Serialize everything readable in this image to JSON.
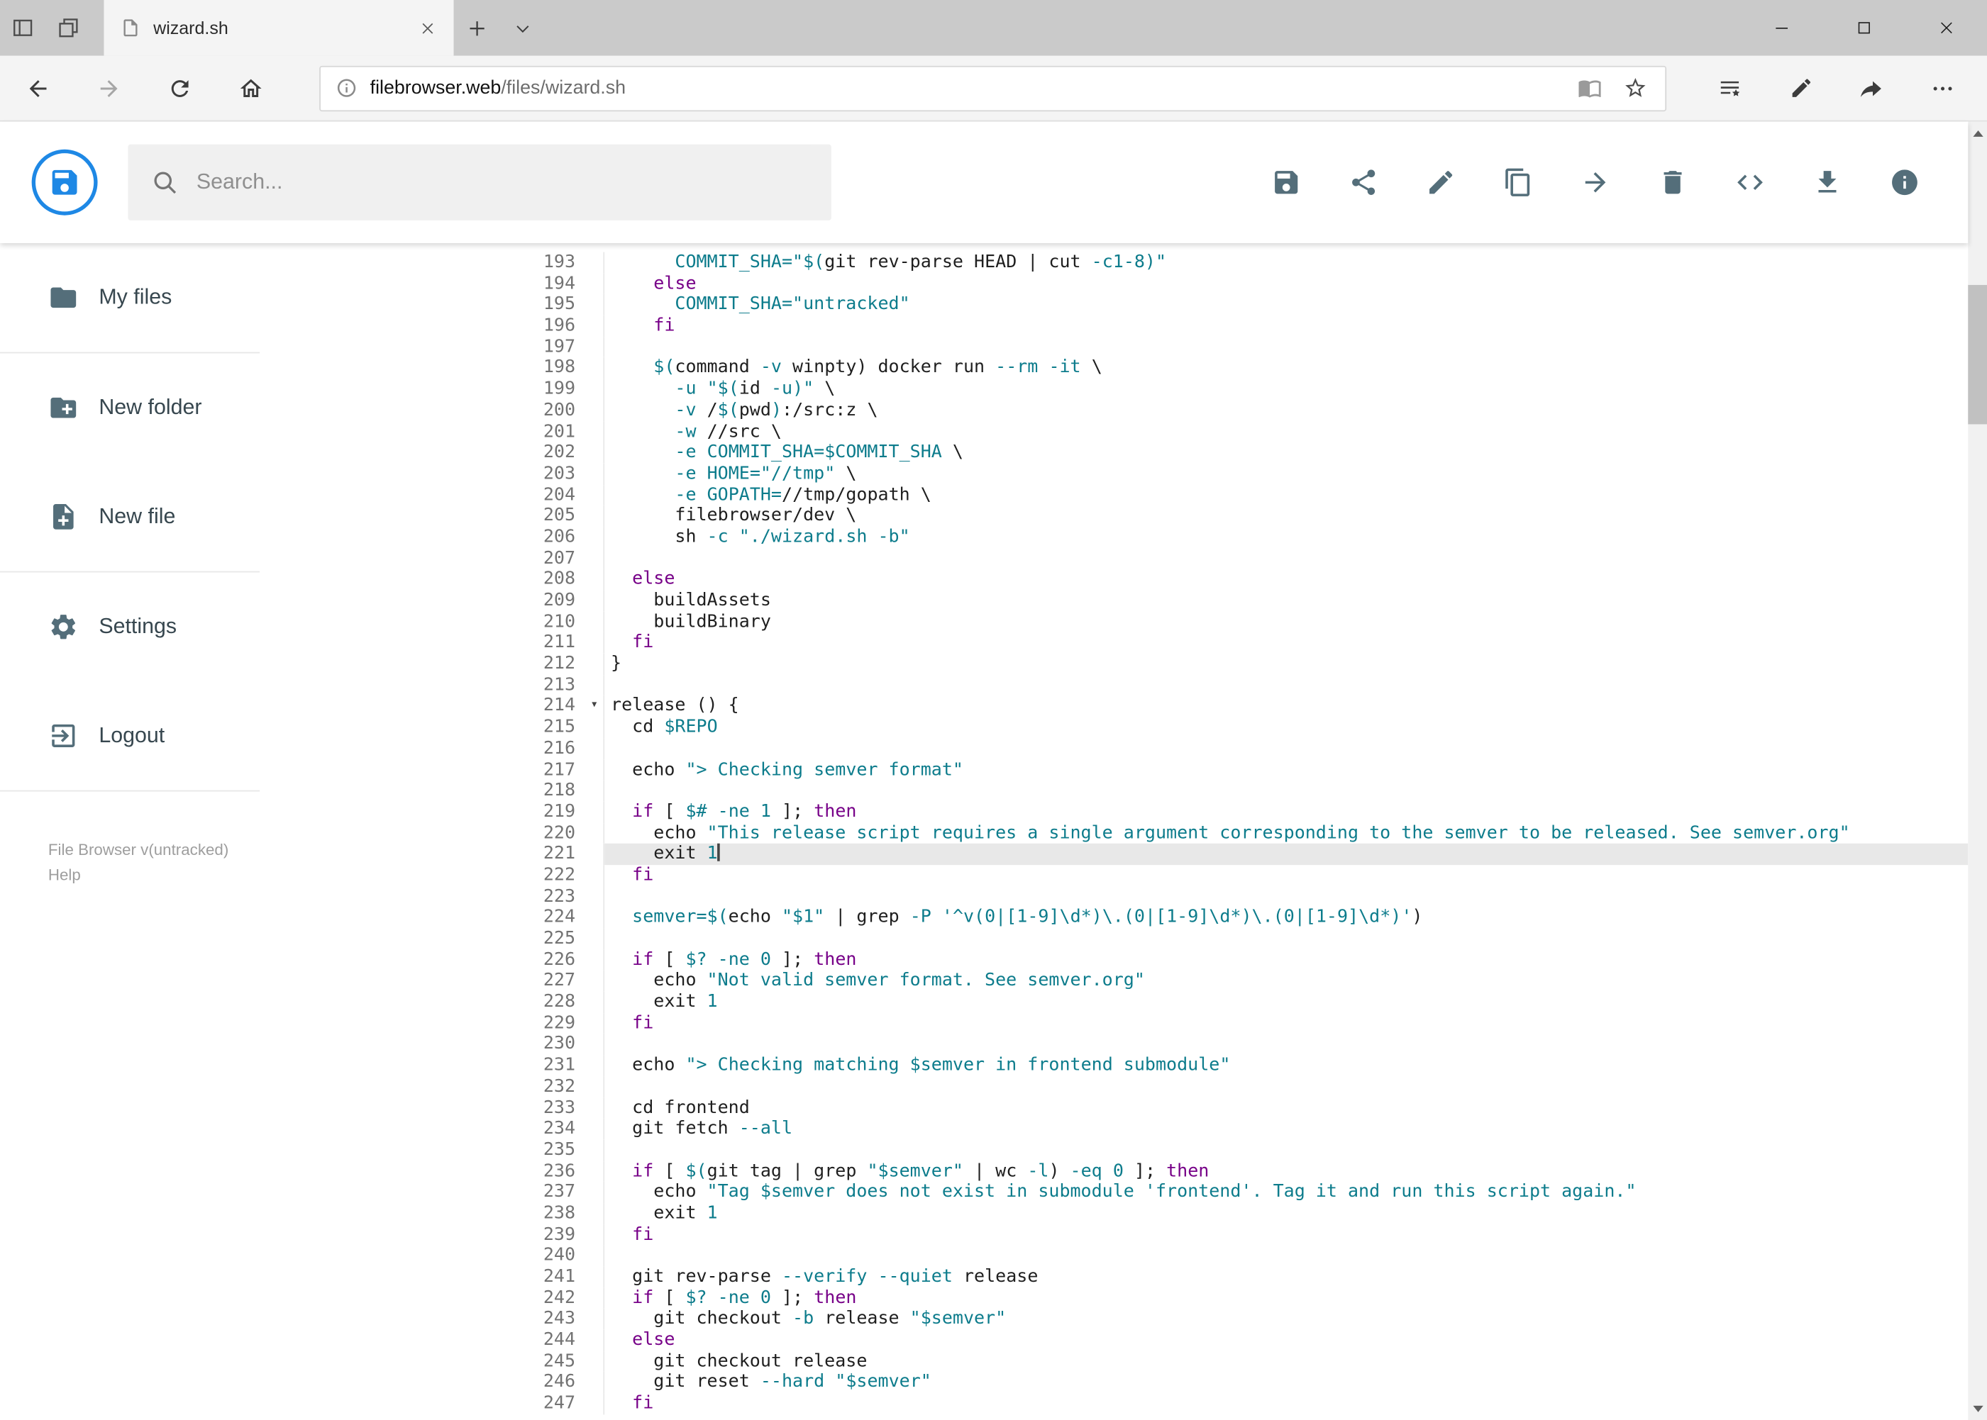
{
  "browser": {
    "tab_title": "wizard.sh",
    "url_domain": "filebrowser.web",
    "url_path": "/files/wizard.sh",
    "nav_icons": [
      "back",
      "forward",
      "refresh",
      "home"
    ],
    "url_field_icons": [
      "site-info",
      "reading-view",
      "favorite-star"
    ],
    "toolbar_icons": [
      "hub-favorites",
      "web-notes",
      "share",
      "more"
    ],
    "window_controls": [
      "minimize",
      "maximize",
      "close"
    ],
    "tabbar_icons": [
      "set-tabs-aside",
      "tabs-you-set-aside",
      "new-tab",
      "tab-preview-chevron"
    ]
  },
  "header": {
    "logo_icon": "floppy-disk",
    "accent_color": "#1e88e5",
    "search_placeholder": "Search...",
    "toolbar": [
      {
        "name": "save",
        "icon": "floppy-icon"
      },
      {
        "name": "share",
        "icon": "share-icon"
      },
      {
        "name": "rename",
        "icon": "pencil-icon"
      },
      {
        "name": "copy",
        "icon": "copy-icon"
      },
      {
        "name": "move",
        "icon": "arrow-forward-icon"
      },
      {
        "name": "delete",
        "icon": "trash-icon"
      },
      {
        "name": "source",
        "icon": "code-icon"
      },
      {
        "name": "download",
        "icon": "download-icon"
      },
      {
        "name": "info",
        "icon": "info-icon"
      }
    ]
  },
  "sidebar": {
    "items": [
      {
        "label": "My files",
        "icon": "folder-icon"
      },
      {
        "label": "New folder",
        "icon": "create-folder-icon"
      },
      {
        "label": "New file",
        "icon": "new-file-icon"
      },
      {
        "label": "Settings",
        "icon": "gear-icon"
      },
      {
        "label": "Logout",
        "icon": "logout-icon"
      }
    ],
    "version": "File Browser v(untracked)",
    "help_label": "Help"
  },
  "editor": {
    "visible_line_range": [
      193,
      247
    ],
    "active_line": 221,
    "colors": {
      "keyword": "#770088",
      "string_var": "#0d7c8c",
      "plain": "#1f1f1f",
      "active_line_bg": "#e8e8e8"
    },
    "lines": [
      {
        "n": 193,
        "t": [
          [
            "p",
            "      "
          ],
          [
            "t",
            "COMMIT_SHA=\"$("
          ],
          [
            "p",
            "git rev-parse HEAD | cut "
          ],
          [
            "t",
            "-c1-8)\""
          ]
        ]
      },
      {
        "n": 194,
        "t": [
          [
            "p",
            "    "
          ],
          [
            "k",
            "else"
          ]
        ]
      },
      {
        "n": 195,
        "t": [
          [
            "p",
            "      "
          ],
          [
            "t",
            "COMMIT_SHA=\"untracked\""
          ]
        ]
      },
      {
        "n": 196,
        "t": [
          [
            "p",
            "    "
          ],
          [
            "k",
            "fi"
          ]
        ]
      },
      {
        "n": 197,
        "t": []
      },
      {
        "n": 198,
        "t": [
          [
            "p",
            "    "
          ],
          [
            "t",
            "$("
          ],
          [
            "p",
            "command "
          ],
          [
            "t",
            "-v"
          ],
          [
            "p",
            " winpty) docker run "
          ],
          [
            "t",
            "--rm"
          ],
          [
            "p",
            " "
          ],
          [
            "t",
            "-it"
          ],
          [
            "p",
            " \\"
          ]
        ]
      },
      {
        "n": 199,
        "t": [
          [
            "p",
            "      "
          ],
          [
            "t",
            "-u"
          ],
          [
            "p",
            " "
          ],
          [
            "t",
            "\"$("
          ],
          [
            "p",
            "id "
          ],
          [
            "t",
            "-u)\""
          ],
          [
            "p",
            " \\"
          ]
        ]
      },
      {
        "n": 200,
        "t": [
          [
            "p",
            "      "
          ],
          [
            "t",
            "-v"
          ],
          [
            "p",
            " /"
          ],
          [
            "t",
            "$("
          ],
          [
            "p",
            "pwd"
          ],
          [
            "t",
            ")"
          ],
          [
            "p",
            ":/src:z \\"
          ]
        ]
      },
      {
        "n": 201,
        "t": [
          [
            "p",
            "      "
          ],
          [
            "t",
            "-w"
          ],
          [
            "p",
            " //src \\"
          ]
        ]
      },
      {
        "n": 202,
        "t": [
          [
            "p",
            "      "
          ],
          [
            "t",
            "-e"
          ],
          [
            "p",
            " "
          ],
          [
            "t",
            "COMMIT_SHA=$COMMIT_SHA"
          ],
          [
            "p",
            " \\"
          ]
        ]
      },
      {
        "n": 203,
        "t": [
          [
            "p",
            "      "
          ],
          [
            "t",
            "-e"
          ],
          [
            "p",
            " "
          ],
          [
            "t",
            "HOME=\"//tmp\""
          ],
          [
            "p",
            " \\"
          ]
        ]
      },
      {
        "n": 204,
        "t": [
          [
            "p",
            "      "
          ],
          [
            "t",
            "-e"
          ],
          [
            "p",
            " "
          ],
          [
            "t",
            "GOPATH="
          ],
          [
            "p",
            "//tmp/gopath \\"
          ]
        ]
      },
      {
        "n": 205,
        "t": [
          [
            "p",
            "      filebrowser/dev \\"
          ]
        ]
      },
      {
        "n": 206,
        "t": [
          [
            "p",
            "      sh "
          ],
          [
            "t",
            "-c"
          ],
          [
            "p",
            " "
          ],
          [
            "t",
            "\"./wizard.sh -b\""
          ]
        ]
      },
      {
        "n": 207,
        "t": []
      },
      {
        "n": 208,
        "t": [
          [
            "p",
            "  "
          ],
          [
            "k",
            "else"
          ]
        ]
      },
      {
        "n": 209,
        "t": [
          [
            "p",
            "    buildAssets"
          ]
        ]
      },
      {
        "n": 210,
        "t": [
          [
            "p",
            "    buildBinary"
          ]
        ]
      },
      {
        "n": 211,
        "t": [
          [
            "p",
            "  "
          ],
          [
            "k",
            "fi"
          ]
        ]
      },
      {
        "n": 212,
        "t": [
          [
            "p",
            "}"
          ]
        ]
      },
      {
        "n": 213,
        "t": []
      },
      {
        "n": 214,
        "fold": true,
        "t": [
          [
            "p",
            "release () {"
          ]
        ]
      },
      {
        "n": 215,
        "t": [
          [
            "p",
            "  cd "
          ],
          [
            "t",
            "$REPO"
          ]
        ]
      },
      {
        "n": 216,
        "t": []
      },
      {
        "n": 217,
        "t": [
          [
            "p",
            "  echo "
          ],
          [
            "t",
            "\"> Checking semver format\""
          ]
        ]
      },
      {
        "n": 218,
        "t": []
      },
      {
        "n": 219,
        "t": [
          [
            "p",
            "  "
          ],
          [
            "k",
            "if"
          ],
          [
            "p",
            " [ "
          ],
          [
            "t",
            "$#"
          ],
          [
            "p",
            " "
          ],
          [
            "t",
            "-ne"
          ],
          [
            "p",
            " "
          ],
          [
            "t",
            "1"
          ],
          [
            "p",
            " ]; "
          ],
          [
            "k",
            "then"
          ]
        ]
      },
      {
        "n": 220,
        "t": [
          [
            "p",
            "    echo "
          ],
          [
            "t",
            "\"This release script requires a single argument corresponding to the semver to be released. See semver.org\""
          ]
        ]
      },
      {
        "n": 221,
        "active": true,
        "cursor": true,
        "t": [
          [
            "p",
            "    exit "
          ],
          [
            "t",
            "1"
          ]
        ]
      },
      {
        "n": 222,
        "t": [
          [
            "p",
            "  "
          ],
          [
            "k",
            "fi"
          ]
        ]
      },
      {
        "n": 223,
        "t": []
      },
      {
        "n": 224,
        "t": [
          [
            "p",
            "  "
          ],
          [
            "t",
            "semver=$("
          ],
          [
            "p",
            "echo "
          ],
          [
            "t",
            "\"$1\""
          ],
          [
            "p",
            " | grep "
          ],
          [
            "t",
            "-P"
          ],
          [
            "p",
            " "
          ],
          [
            "t",
            "'^v(0|[1-9]\\d*)\\.(0|[1-9]\\d*)\\.(0|[1-9]\\d*)'"
          ],
          [
            "p",
            ")"
          ]
        ]
      },
      {
        "n": 225,
        "t": []
      },
      {
        "n": 226,
        "t": [
          [
            "p",
            "  "
          ],
          [
            "k",
            "if"
          ],
          [
            "p",
            " [ "
          ],
          [
            "t",
            "$?"
          ],
          [
            "p",
            " "
          ],
          [
            "t",
            "-ne"
          ],
          [
            "p",
            " "
          ],
          [
            "t",
            "0"
          ],
          [
            "p",
            " ]; "
          ],
          [
            "k",
            "then"
          ]
        ]
      },
      {
        "n": 227,
        "t": [
          [
            "p",
            "    echo "
          ],
          [
            "t",
            "\"Not valid semver format. See semver.org\""
          ]
        ]
      },
      {
        "n": 228,
        "t": [
          [
            "p",
            "    exit "
          ],
          [
            "t",
            "1"
          ]
        ]
      },
      {
        "n": 229,
        "t": [
          [
            "p",
            "  "
          ],
          [
            "k",
            "fi"
          ]
        ]
      },
      {
        "n": 230,
        "t": []
      },
      {
        "n": 231,
        "t": [
          [
            "p",
            "  echo "
          ],
          [
            "t",
            "\"> Checking matching $semver in frontend submodule\""
          ]
        ]
      },
      {
        "n": 232,
        "t": []
      },
      {
        "n": 233,
        "t": [
          [
            "p",
            "  cd frontend"
          ]
        ]
      },
      {
        "n": 234,
        "t": [
          [
            "p",
            "  git fetch "
          ],
          [
            "t",
            "--all"
          ]
        ]
      },
      {
        "n": 235,
        "t": []
      },
      {
        "n": 236,
        "t": [
          [
            "p",
            "  "
          ],
          [
            "k",
            "if"
          ],
          [
            "p",
            " [ "
          ],
          [
            "t",
            "$("
          ],
          [
            "p",
            "git tag | grep "
          ],
          [
            "t",
            "\"$semver\""
          ],
          [
            "p",
            " | wc "
          ],
          [
            "t",
            "-l"
          ],
          [
            "p",
            ") "
          ],
          [
            "t",
            "-eq"
          ],
          [
            "p",
            " "
          ],
          [
            "t",
            "0"
          ],
          [
            "p",
            " ]; "
          ],
          [
            "k",
            "then"
          ]
        ]
      },
      {
        "n": 237,
        "t": [
          [
            "p",
            "    echo "
          ],
          [
            "t",
            "\"Tag $semver does not exist in submodule 'frontend'. Tag it and run this script again.\""
          ]
        ]
      },
      {
        "n": 238,
        "t": [
          [
            "p",
            "    exit "
          ],
          [
            "t",
            "1"
          ]
        ]
      },
      {
        "n": 239,
        "t": [
          [
            "p",
            "  "
          ],
          [
            "k",
            "fi"
          ]
        ]
      },
      {
        "n": 240,
        "t": []
      },
      {
        "n": 241,
        "t": [
          [
            "p",
            "  git rev-parse "
          ],
          [
            "t",
            "--verify"
          ],
          [
            "p",
            " "
          ],
          [
            "t",
            "--quiet"
          ],
          [
            "p",
            " release"
          ]
        ]
      },
      {
        "n": 242,
        "t": [
          [
            "p",
            "  "
          ],
          [
            "k",
            "if"
          ],
          [
            "p",
            " [ "
          ],
          [
            "t",
            "$?"
          ],
          [
            "p",
            " "
          ],
          [
            "t",
            "-ne"
          ],
          [
            "p",
            " "
          ],
          [
            "t",
            "0"
          ],
          [
            "p",
            " ]; "
          ],
          [
            "k",
            "then"
          ]
        ]
      },
      {
        "n": 243,
        "t": [
          [
            "p",
            "    git checkout "
          ],
          [
            "t",
            "-b"
          ],
          [
            "p",
            " release "
          ],
          [
            "t",
            "\"$semver\""
          ]
        ]
      },
      {
        "n": 244,
        "t": [
          [
            "p",
            "  "
          ],
          [
            "k",
            "else"
          ]
        ]
      },
      {
        "n": 245,
        "t": [
          [
            "p",
            "    git checkout release"
          ]
        ]
      },
      {
        "n": 246,
        "t": [
          [
            "p",
            "    git reset "
          ],
          [
            "t",
            "--hard"
          ],
          [
            "p",
            " "
          ],
          [
            "t",
            "\"$semver\""
          ]
        ]
      },
      {
        "n": 247,
        "t": [
          [
            "p",
            "  "
          ],
          [
            "k",
            "fi"
          ]
        ]
      }
    ]
  }
}
